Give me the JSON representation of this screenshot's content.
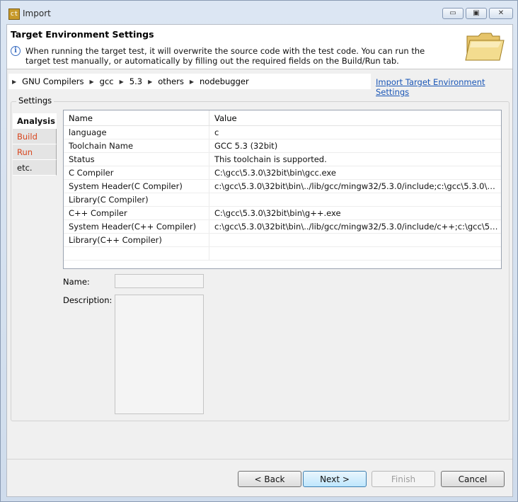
{
  "window": {
    "title": "Import",
    "app_icon_text": "ct",
    "controls": {
      "minimize": "▭",
      "maximize": "▣",
      "close": "✕"
    }
  },
  "header": {
    "title": "Target Environment Settings",
    "info_icon": "i",
    "info_text": "When running the target test, it will overwrite the source code with the test code. You can run the target test manually, or automatically by filling out the required fields on the Build/Run tab."
  },
  "breadcrumb": [
    "GNU Compilers",
    "gcc",
    "5.3",
    "others",
    "nodebugger"
  ],
  "import_link": "Import Target Environment Settings",
  "settings": {
    "label": "Settings",
    "tabs": [
      {
        "label": "Analysis"
      },
      {
        "label": "Build"
      },
      {
        "label": "Run"
      },
      {
        "label": "etc."
      }
    ]
  },
  "table": {
    "headers": [
      "Name",
      "Value"
    ],
    "rows": [
      [
        "language",
        "c"
      ],
      [
        "Toolchain Name",
        "GCC 5.3 (32bit)"
      ],
      [
        "Status",
        "This toolchain is supported."
      ],
      [
        "C Compiler",
        "C:\\gcc\\5.3.0\\32bit\\bin\\gcc.exe"
      ],
      [
        "System Header(C Compiler)",
        "c:\\gcc\\5.3.0\\32bit\\bin\\../lib/gcc/mingw32/5.3.0/include;c:\\gcc\\5.3.0\\32bi..."
      ],
      [
        "Library(C Compiler)",
        ""
      ],
      [
        "C++ Compiler",
        "C:\\gcc\\5.3.0\\32bit\\bin\\g++.exe"
      ],
      [
        "System Header(C++ Compiler)",
        "c:\\gcc\\5.3.0\\32bit\\bin\\../lib/gcc/mingw32/5.3.0/include/c++;c:\\gcc\\5.3.0..."
      ],
      [
        "Library(C++ Compiler)",
        ""
      ],
      [
        "",
        ""
      ]
    ]
  },
  "details": {
    "name_label": "Name:",
    "name_value": "",
    "description_label": "Description:",
    "description_value": ""
  },
  "buttons": {
    "back": "< Back",
    "next": "Next >",
    "finish": "Finish",
    "cancel": "Cancel"
  },
  "colors": {
    "accent_link": "#1a56b6",
    "tab_red": "#d8461e",
    "primary_button": "#bee6fd"
  }
}
